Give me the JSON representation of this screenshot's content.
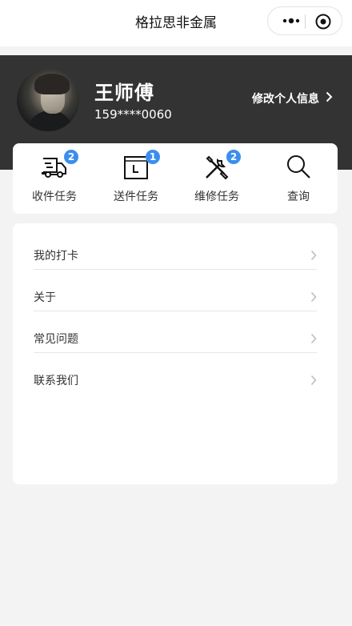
{
  "titlebar": {
    "title": "格拉思非金属",
    "more_icon": "more-dots-icon",
    "close_icon": "target-circle-icon"
  },
  "profile": {
    "name": "王师傅",
    "phone": "159****0060",
    "edit_label": "修改个人信息",
    "avatar_icon": "user-avatar"
  },
  "tasks": [
    {
      "label": "收件任务",
      "badge": "2",
      "icon": "delivery-truck-icon"
    },
    {
      "label": "送件任务",
      "badge": "1",
      "icon": "calendar-clock-icon"
    },
    {
      "label": "维修任务",
      "badge": "2",
      "icon": "tools-icon"
    },
    {
      "label": "查询",
      "badge": null,
      "icon": "search-icon"
    }
  ],
  "menu": [
    {
      "label": "我的打卡"
    },
    {
      "label": "关于"
    },
    {
      "label": "常见问题"
    },
    {
      "label": "联系我们"
    }
  ],
  "colors": {
    "header_bg": "#333333",
    "badge": "#3b8ef0",
    "page_bg": "#f3f3f3"
  }
}
